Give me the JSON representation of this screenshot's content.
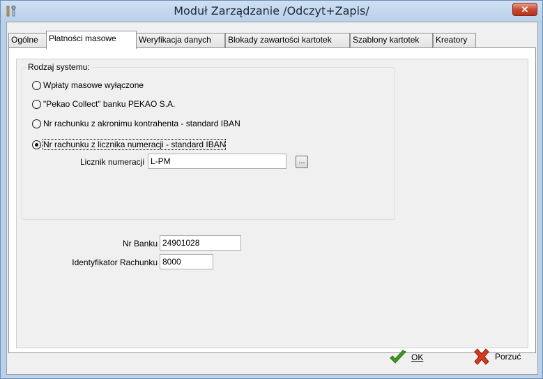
{
  "window": {
    "title": "Moduł Zarządzanie /Odczyt+Zapis/",
    "close_glyph": "✕"
  },
  "tabs": [
    {
      "label": "Ogólne",
      "active": false
    },
    {
      "label": "Płatności masowe",
      "active": true
    },
    {
      "label": "Weryfikacja danych",
      "active": false
    },
    {
      "label": "Blokady zawartości kartotek",
      "active": false
    },
    {
      "label": "Szablony kartotek",
      "active": false
    },
    {
      "label": "Kreatory",
      "active": false
    }
  ],
  "system_group": {
    "legend": "Rodzaj systemu:",
    "options": [
      {
        "label": "Wpłaty masowe wyłączone",
        "checked": false
      },
      {
        "label": "\"Pekao Collect\" banku PEKAO S.A.",
        "checked": false
      },
      {
        "label": "Nr rachunku z akronimu kontrahenta - standard IBAN",
        "checked": false
      },
      {
        "label": "Nr rachunku z licznika numeracji - standard IBAN",
        "checked": true
      }
    ],
    "counter": {
      "label": "Licznik numeracji",
      "value": "L-PM",
      "button": "..."
    }
  },
  "bank": {
    "nr_banku_label": "Nr Banku",
    "nr_banku_value": "24901028",
    "ident_label": "Identyfikator Rachunku",
    "ident_value": "8000"
  },
  "buttons": {
    "ok_label": "OK",
    "cancel_label": "Porzuć"
  },
  "colors": {
    "ok_icon": "#3f9a1f",
    "cancel_icon": "#d63a1e",
    "close_button": "#c84a31"
  },
  "icons": {
    "app": "tools-icon",
    "ok": "checkmark-icon",
    "cancel": "x-mark-icon"
  }
}
